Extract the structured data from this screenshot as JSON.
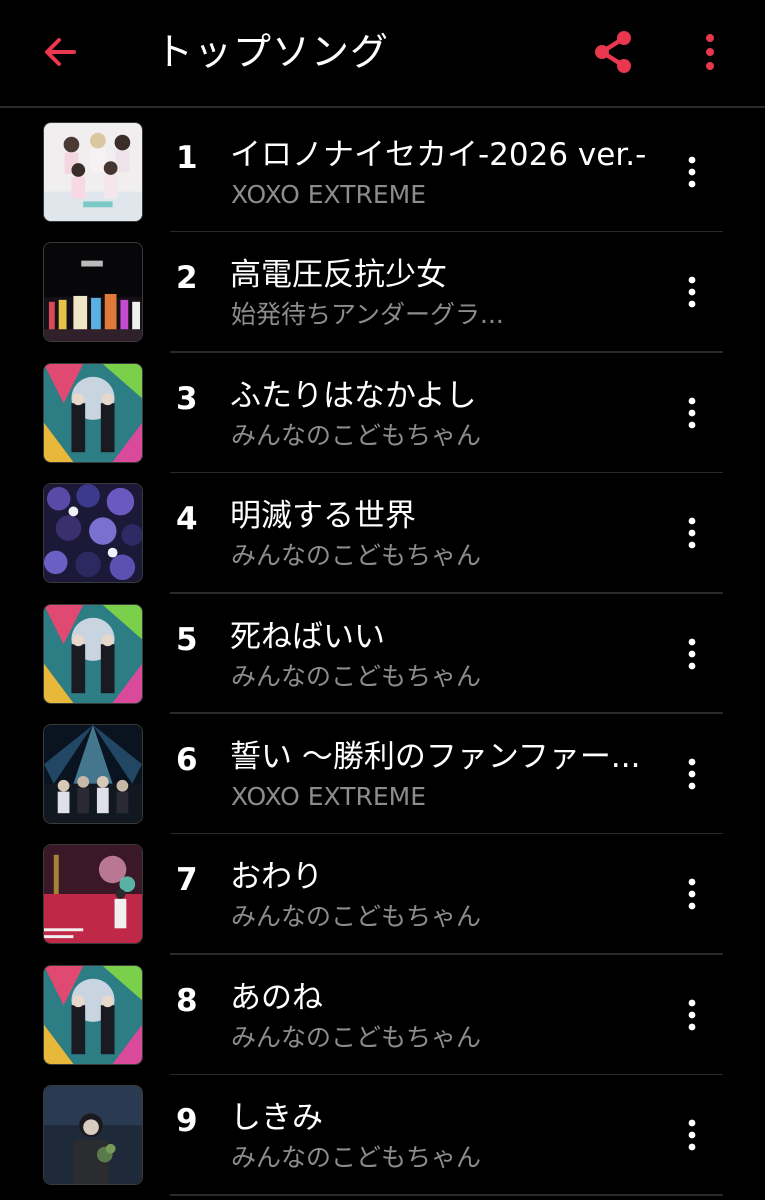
{
  "header": {
    "title": "トップソング",
    "back_icon": "arrow-left-icon",
    "share_icon": "share-icon",
    "more_icon": "more-vertical-icon",
    "accent_color": "#e8374e"
  },
  "songs": [
    {
      "rank": "1",
      "title": "イロノナイセカイ-2026 ver.-",
      "artist": "XOXO EXTREME",
      "art": "group-photo-white"
    },
    {
      "rank": "2",
      "title": "高電圧反抗少女",
      "artist": "始発待ちアンダーグラ...",
      "art": "night-city"
    },
    {
      "rank": "3",
      "title": "ふたりはなかよし",
      "artist": "みんなのこどもちゃん",
      "art": "colorful-collage"
    },
    {
      "rank": "4",
      "title": "明滅する世界",
      "artist": "みんなのこどもちゃん",
      "art": "purple-pattern"
    },
    {
      "rank": "5",
      "title": "死ねばいい",
      "artist": "みんなのこどもちゃん",
      "art": "colorful-collage"
    },
    {
      "rank": "6",
      "title": "誓い 〜勝利のファンファー...",
      "artist": "XOXO EXTREME",
      "art": "stage-lights"
    },
    {
      "rank": "7",
      "title": "おわり",
      "artist": "みんなのこどもちゃん",
      "art": "pink-street"
    },
    {
      "rank": "8",
      "title": "あのね",
      "artist": "みんなのこどもちゃん",
      "art": "colorful-collage"
    },
    {
      "rank": "9",
      "title": "しきみ",
      "artist": "みんなのこどもちゃん",
      "art": "dark-portrait"
    }
  ]
}
